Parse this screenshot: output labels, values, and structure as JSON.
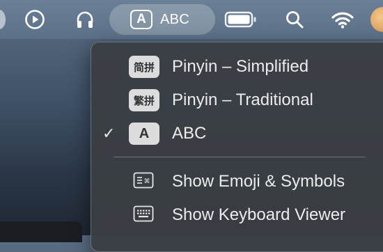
{
  "menubar": {
    "items": [
      {
        "icon": "partial-status-icon"
      },
      {
        "icon": "play-circle-icon"
      },
      {
        "icon": "headphones-icon"
      },
      {
        "icon": "input-source-icon",
        "glyph": "A",
        "label": "ABC"
      },
      {
        "icon": "battery-icon"
      },
      {
        "icon": "search-icon"
      },
      {
        "icon": "wifi-icon"
      },
      {
        "icon": "avatar"
      }
    ]
  },
  "menu": {
    "items": [
      {
        "badge": "简拼",
        "label": "Pinyin – Simplified",
        "checked": false
      },
      {
        "badge": "繁拼",
        "label": "Pinyin – Traditional",
        "checked": false
      },
      {
        "badge": "A",
        "label": "ABC",
        "checked": true,
        "checkmark": "✓"
      },
      {
        "icon": "emoji-keyboard-icon",
        "label": "Show Emoji & Symbols"
      },
      {
        "icon": "keyboard-icon",
        "label": "Show Keyboard Viewer"
      }
    ]
  }
}
